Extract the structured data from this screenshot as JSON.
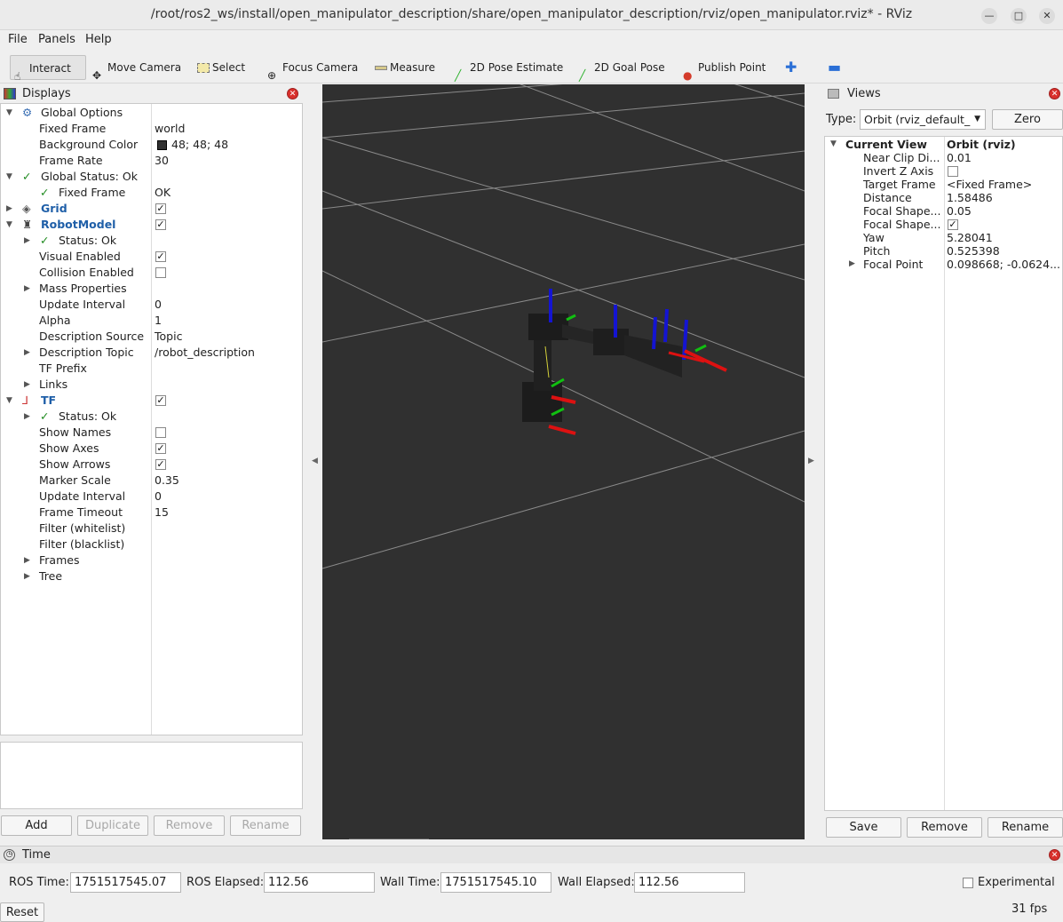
{
  "window": {
    "title": "/root/ros2_ws/install/open_manipulator_description/share/open_manipulator_description/rviz/open_manipulator.rviz* - RViz"
  },
  "menu": [
    "File",
    "Panels",
    "Help"
  ],
  "toolbar": {
    "interact": "Interact",
    "move_camera": "Move Camera",
    "select": "Select",
    "focus_camera": "Focus Camera",
    "measure": "Measure",
    "pose_estimate": "2D Pose Estimate",
    "goal_pose": "2D Goal Pose",
    "publish_point": "Publish Point"
  },
  "displays": {
    "title": "Displays",
    "global_options": "Global Options",
    "fixed_frame_label": "Fixed Frame",
    "fixed_frame_value": "world",
    "bg_color_label": "Background Color",
    "bg_color_value": "48; 48; 48",
    "frame_rate_label": "Frame Rate",
    "frame_rate_value": "30",
    "global_status": "Global Status: Ok",
    "gs_fixed_frame_label": "Fixed Frame",
    "gs_fixed_frame_value": "OK",
    "grid": "Grid",
    "robot_model": "RobotModel",
    "rm_status": "Status: Ok",
    "visual_enabled": "Visual Enabled",
    "collision_enabled": "Collision Enabled",
    "mass_properties": "Mass Properties",
    "update_interval_label": "Update Interval",
    "update_interval_value": "0",
    "alpha_label": "Alpha",
    "alpha_value": "1",
    "desc_source_label": "Description Source",
    "desc_source_value": "Topic",
    "desc_topic_label": "Description Topic",
    "desc_topic_value": "/robot_description",
    "tf_prefix": "TF Prefix",
    "links": "Links",
    "tf": "TF",
    "tf_status": "Status: Ok",
    "show_names": "Show Names",
    "show_axes": "Show Axes",
    "show_arrows": "Show Arrows",
    "marker_scale_label": "Marker Scale",
    "marker_scale_value": "0.35",
    "tf_update_interval_label": "Update Interval",
    "tf_update_interval_value": "0",
    "frame_timeout_label": "Frame Timeout",
    "frame_timeout_value": "15",
    "filter_white": "Filter (whitelist)",
    "filter_black": "Filter (blacklist)",
    "frames": "Frames",
    "tree": "Tree",
    "buttons": {
      "add": "Add",
      "duplicate": "Duplicate",
      "remove": "Remove",
      "rename": "Rename"
    },
    "bg_swatch_color": "#303030"
  },
  "views": {
    "title": "Views",
    "type_label": "Type:",
    "type_value": "Orbit (rviz_default_",
    "zero": "Zero",
    "current_view": "Current View",
    "current_view_value": "Orbit (rviz)",
    "near_clip_label": "Near Clip Di...",
    "near_clip_value": "0.01",
    "invert_z_label": "Invert Z Axis",
    "target_frame_label": "Target Frame",
    "target_frame_value": "<Fixed Frame>",
    "distance_label": "Distance",
    "distance_value": "1.58486",
    "focal_size_label": "Focal Shape...",
    "focal_size_value": "0.05",
    "focal_fixed_label": "Focal Shape...",
    "yaw_label": "Yaw",
    "yaw_value": "5.28041",
    "pitch_label": "Pitch",
    "pitch_value": "0.525398",
    "focal_point_label": "Focal Point",
    "focal_point_value": "0.098668; -0.0624...",
    "buttons": {
      "save": "Save",
      "remove": "Remove",
      "rename": "Rename"
    }
  },
  "time": {
    "title": "Time",
    "ros_time_label": "ROS Time:",
    "ros_time_value": "1751517545.07",
    "ros_elapsed_label": "ROS Elapsed:",
    "ros_elapsed_value": "112.56",
    "wall_time_label": "Wall Time:",
    "wall_time_value": "1751517545.10",
    "wall_elapsed_label": "Wall Elapsed:",
    "wall_elapsed_value": "112.56",
    "experimental": "Experimental"
  },
  "status": {
    "reset": "Reset",
    "fps": "31 fps"
  }
}
